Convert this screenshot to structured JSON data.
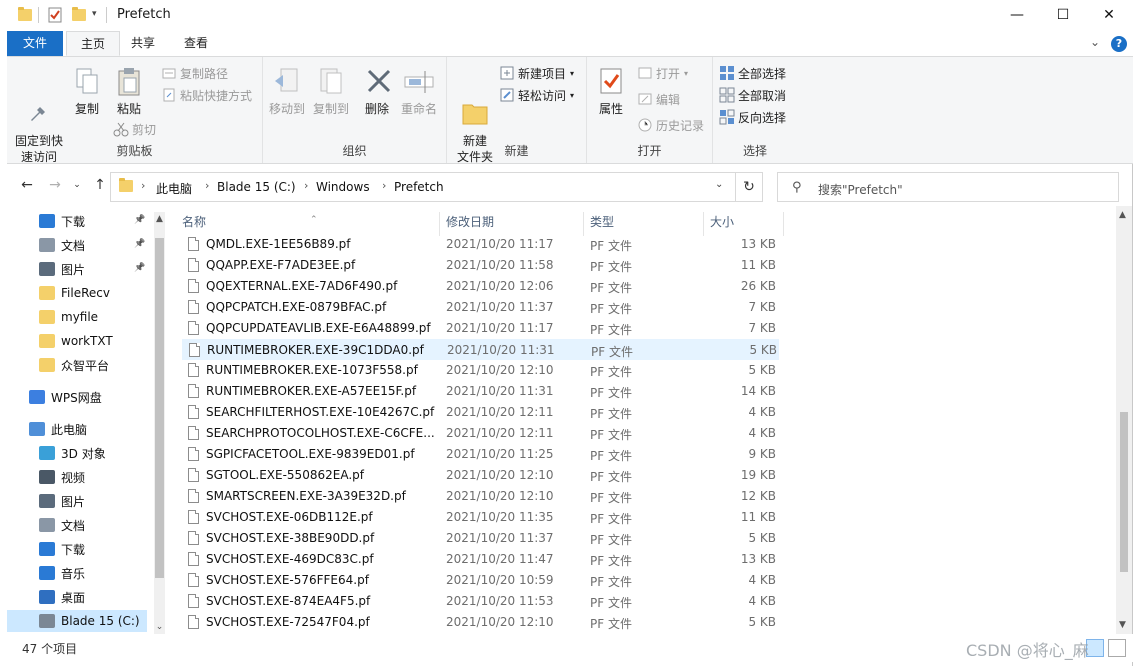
{
  "window": {
    "title": "Prefetch"
  },
  "title_buttons": {
    "minimize": "—",
    "maximize": "☐",
    "close": "✕"
  },
  "ribbon_tabs": {
    "file": "文件",
    "home": "主页",
    "share": "共享",
    "view": "查看"
  },
  "ribbon": {
    "clipboard": {
      "label": "剪贴板",
      "pin_quick_access": "固定到快\n速访问",
      "copy": "复制",
      "paste": "粘贴",
      "copy_path": "复制路径",
      "paste_shortcut": "粘贴快捷方式",
      "cut": "剪切"
    },
    "organize": {
      "label": "组织",
      "move_to": "移动到",
      "copy_to": "复制到",
      "delete": "删除",
      "rename": "重命名"
    },
    "new": {
      "label": "新建",
      "new_folder": "新建\n文件夹",
      "new_item": "新建项目",
      "easy_access": "轻松访问"
    },
    "open": {
      "label": "打开",
      "properties": "属性",
      "open": "打开",
      "edit": "编辑",
      "history": "历史记录"
    },
    "select": {
      "label": "选择",
      "select_all": "全部选择",
      "select_none": "全部取消",
      "invert": "反向选择"
    }
  },
  "address": {
    "crumbs": [
      "此电脑",
      "Blade 15 (C:)",
      "Windows",
      "Prefetch"
    ],
    "search_placeholder": "搜索\"Prefetch\""
  },
  "navpane": {
    "items": [
      {
        "label": "下载",
        "icon": "download-icon",
        "pinned": true
      },
      {
        "label": "文档",
        "icon": "documents-icon",
        "pinned": true
      },
      {
        "label": "图片",
        "icon": "pictures-icon",
        "pinned": true
      },
      {
        "label": "FileRecv",
        "icon": "folder-icon",
        "pinned": false
      },
      {
        "label": "myfile",
        "icon": "folder-icon",
        "pinned": false
      },
      {
        "label": "workTXT",
        "icon": "folder-icon",
        "pinned": false
      },
      {
        "label": "众智平台",
        "icon": "folder-icon",
        "pinned": false
      },
      {
        "label": "WPS网盘",
        "icon": "cloud-icon",
        "pinned": false
      },
      {
        "label": "此电脑",
        "icon": "computer-icon",
        "pinned": false
      },
      {
        "label": "3D 对象",
        "icon": "3d-objects-icon",
        "pinned": false
      },
      {
        "label": "视频",
        "icon": "videos-icon",
        "pinned": false
      },
      {
        "label": "图片",
        "icon": "pictures-icon",
        "pinned": false
      },
      {
        "label": "文档",
        "icon": "documents-icon",
        "pinned": false
      },
      {
        "label": "下载",
        "icon": "download-icon",
        "pinned": false
      },
      {
        "label": "音乐",
        "icon": "music-icon",
        "pinned": false
      },
      {
        "label": "桌面",
        "icon": "desktop-icon",
        "pinned": false
      },
      {
        "label": "Blade 15 (C:)",
        "icon": "drive-icon",
        "pinned": false,
        "selected": true
      }
    ]
  },
  "columns": {
    "name": "名称",
    "date": "修改日期",
    "type": "类型",
    "size": "大小"
  },
  "files": [
    {
      "name": "QMDL.EXE-1EE56B89.pf",
      "date": "2021/10/20 11:17",
      "type": "PF 文件",
      "size": "13 KB"
    },
    {
      "name": "QQAPP.EXE-F7ADE3EE.pf",
      "date": "2021/10/20 11:58",
      "type": "PF 文件",
      "size": "11 KB"
    },
    {
      "name": "QQEXTERNAL.EXE-7AD6F490.pf",
      "date": "2021/10/20 12:06",
      "type": "PF 文件",
      "size": "26 KB"
    },
    {
      "name": "QQPCPATCH.EXE-0879BFAC.pf",
      "date": "2021/10/20 11:37",
      "type": "PF 文件",
      "size": "7 KB"
    },
    {
      "name": "QQPCUPDATEAVLIB.EXE-E6A48899.pf",
      "date": "2021/10/20 11:17",
      "type": "PF 文件",
      "size": "7 KB"
    },
    {
      "name": "RUNTIMEBROKER.EXE-39C1DDA0.pf",
      "date": "2021/10/20 11:31",
      "type": "PF 文件",
      "size": "5 KB",
      "hover": true
    },
    {
      "name": "RUNTIMEBROKER.EXE-1073F558.pf",
      "date": "2021/10/20 12:10",
      "type": "PF 文件",
      "size": "5 KB"
    },
    {
      "name": "RUNTIMEBROKER.EXE-A57EE15F.pf",
      "date": "2021/10/20 11:31",
      "type": "PF 文件",
      "size": "14 KB"
    },
    {
      "name": "SEARCHFILTERHOST.EXE-10E4267C.pf",
      "date": "2021/10/20 12:11",
      "type": "PF 文件",
      "size": "4 KB"
    },
    {
      "name": "SEARCHPROTOCOLHOST.EXE-C6CFE...",
      "date": "2021/10/20 12:11",
      "type": "PF 文件",
      "size": "4 KB"
    },
    {
      "name": "SGPICFACETOOL.EXE-9839ED01.pf",
      "date": "2021/10/20 11:25",
      "type": "PF 文件",
      "size": "9 KB"
    },
    {
      "name": "SGTOOL.EXE-550862EA.pf",
      "date": "2021/10/20 12:10",
      "type": "PF 文件",
      "size": "19 KB"
    },
    {
      "name": "SMARTSCREEN.EXE-3A39E32D.pf",
      "date": "2021/10/20 12:10",
      "type": "PF 文件",
      "size": "12 KB"
    },
    {
      "name": "SVCHOST.EXE-06DB112E.pf",
      "date": "2021/10/20 11:35",
      "type": "PF 文件",
      "size": "11 KB"
    },
    {
      "name": "SVCHOST.EXE-38BE90DD.pf",
      "date": "2021/10/20 11:37",
      "type": "PF 文件",
      "size": "5 KB"
    },
    {
      "name": "SVCHOST.EXE-469DC83C.pf",
      "date": "2021/10/20 11:47",
      "type": "PF 文件",
      "size": "13 KB"
    },
    {
      "name": "SVCHOST.EXE-576FFE64.pf",
      "date": "2021/10/20 10:59",
      "type": "PF 文件",
      "size": "4 KB"
    },
    {
      "name": "SVCHOST.EXE-874EA4F5.pf",
      "date": "2021/10/20 11:53",
      "type": "PF 文件",
      "size": "4 KB"
    },
    {
      "name": "SVCHOST.EXE-72547F04.pf",
      "date": "2021/10/20 12:10",
      "type": "PF 文件",
      "size": "5 KB"
    }
  ],
  "status": {
    "item_count": "47 个项目"
  },
  "watermark": "CSDN @将心_麻",
  "colors": {
    "accent": "#1a6fc6",
    "selection": "#cce8ff",
    "hover": "#e5f3ff"
  }
}
